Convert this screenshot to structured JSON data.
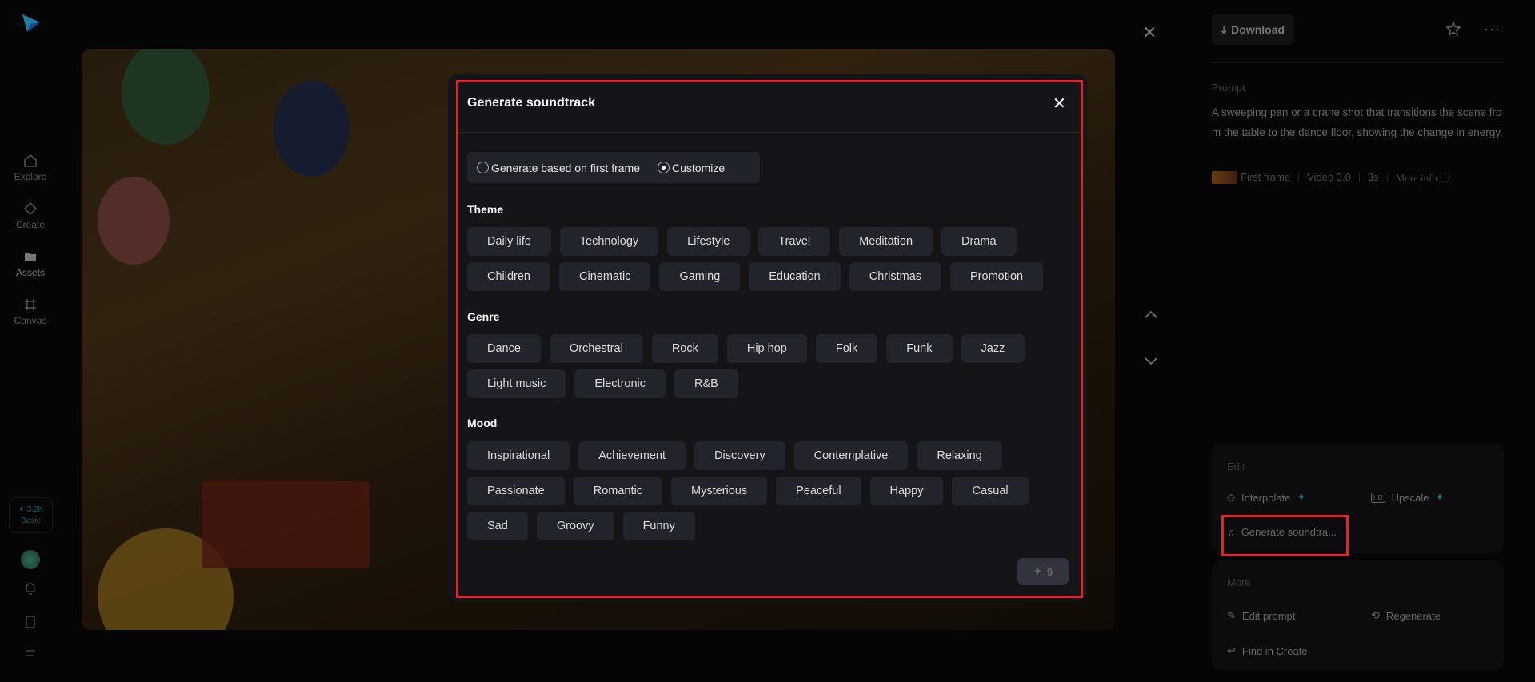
{
  "sidebar": {
    "items": [
      {
        "label": "Explore"
      },
      {
        "label": "Create"
      },
      {
        "label": "Assets"
      },
      {
        "label": "Canvas"
      }
    ],
    "credits": "✦ 3.2K",
    "plan": "Basic"
  },
  "toolbar": {
    "download": "Download"
  },
  "prompt": {
    "label": "Prompt",
    "text": "A sweeping pan or a crane shot that transitions the scene from the table to the dance floor, showing the change in energy.",
    "first_frame": "First frame",
    "model": "Video 3.0",
    "duration": "3s",
    "more_info": "More info"
  },
  "edit": {
    "title": "Edit",
    "interpolate": "Interpolate",
    "upscale": "Upscale",
    "soundtrack": "Generate soundtra..."
  },
  "more": {
    "title": "More",
    "edit_prompt": "Edit prompt",
    "regenerate": "Regenerate",
    "find": "Find in Create"
  },
  "modal": {
    "title": "Generate soundtrack",
    "options": [
      "Generate based on first frame",
      "Customize"
    ],
    "selected": "Customize",
    "theme_label": "Theme",
    "themes": [
      "Daily life",
      "Technology",
      "Lifestyle",
      "Travel",
      "Meditation",
      "Drama",
      "Children",
      "Cinematic",
      "Gaming",
      "Education",
      "Christmas",
      "Promotion"
    ],
    "genre_label": "Genre",
    "genres": [
      "Dance",
      "Orchestral",
      "Rock",
      "Hip hop",
      "Folk",
      "Funk",
      "Jazz",
      "Light music",
      "Electronic",
      "R&B"
    ],
    "mood_label": "Mood",
    "moods": [
      "Inspirational",
      "Achievement",
      "Discovery",
      "Contemplative",
      "Relaxing",
      "Passionate",
      "Romantic",
      "Mysterious",
      "Peaceful",
      "Happy",
      "Casual",
      "Sad",
      "Groovy",
      "Funny"
    ],
    "cost": "9"
  },
  "colors": {
    "accent": "#1a7a80",
    "highlight": "#e4222a"
  }
}
